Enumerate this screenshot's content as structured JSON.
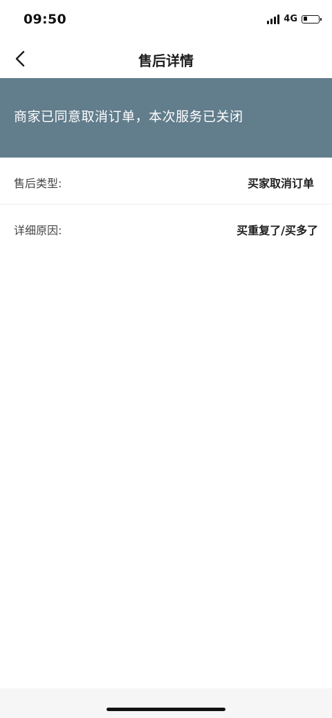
{
  "status_bar": {
    "time": "09:50",
    "network": "4G",
    "signal_icon": "signal-bars-icon",
    "battery_icon": "battery-icon",
    "battery_level": 0.25
  },
  "nav": {
    "back_icon": "chevron-left-icon",
    "title": "售后详情"
  },
  "banner": {
    "message": "商家已同意取消订单，本次服务已关闭",
    "background_color": "#627d8c"
  },
  "details": {
    "type_label": "售后类型:",
    "type_value": "买家取消订单",
    "reason_label": "详细原因:",
    "reason_value": "买重复了/买多了"
  }
}
